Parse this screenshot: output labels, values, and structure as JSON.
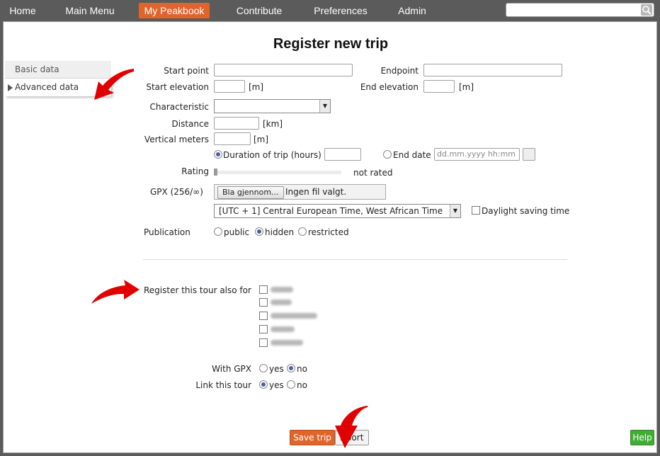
{
  "nav": {
    "home": "Home",
    "main_menu": "Main Menu",
    "my_peakbook": "My Peakbook",
    "contribute": "Contribute",
    "preferences": "Preferences",
    "admin": "Admin"
  },
  "search": {
    "value": ""
  },
  "page": {
    "title": "Register new trip"
  },
  "sidebar": {
    "items": [
      {
        "label": "Basic data"
      },
      {
        "label": "Advanced data"
      }
    ]
  },
  "form": {
    "start_point": "Start point",
    "endpoint": "Endpoint",
    "start_elevation": "Start elevation",
    "end_elevation": "End elevation",
    "unit_m": "[m]",
    "characteristic": "Characteristic",
    "distance": "Distance",
    "unit_km": "[km]",
    "vertical_meters": "Vertical meters",
    "duration_label": "Duration of trip (hours)",
    "end_date_label": "End date",
    "end_date_placeholder": "dd.mm.yyyy hh:mm",
    "rating": "Rating",
    "rating_value": "not rated",
    "gpx_label": "GPX  (256/∞)",
    "file_button": "Bla gjennom...",
    "file_status": "Ingen fil valgt.",
    "timezone": "[UTC + 1] Central European Time, West African Time",
    "daylight": "Daylight saving time",
    "publication": "Publication",
    "pub_public": "public",
    "pub_hidden": "hidden",
    "pub_restricted": "restricted",
    "register_also": "Register this tour also for",
    "with_gpx": "With GPX",
    "link_tour": "Link this tour",
    "yes": "yes",
    "no": "no"
  },
  "buttons": {
    "save": "Save trip",
    "abort": "Abort",
    "help": "Help"
  },
  "colors": {
    "accent": "#e0652a",
    "nav_bg": "#5b5b5b",
    "help": "#3fae33",
    "arrow": "#e00000"
  }
}
